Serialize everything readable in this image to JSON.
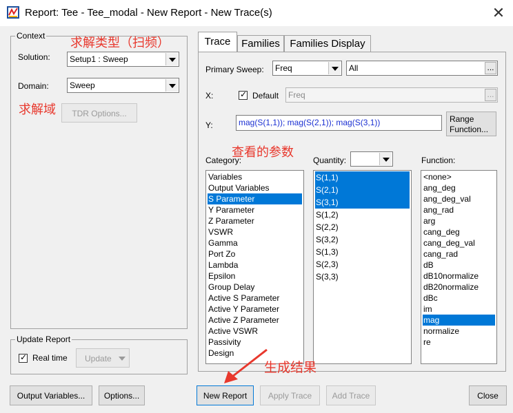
{
  "window": {
    "title": "Report: Tee - Tee_modal - New Report - New Trace(s)"
  },
  "context": {
    "group_label": "Context",
    "solution_label": "Solution:",
    "solution_value": "Setup1 : Sweep",
    "domain_label": "Domain:",
    "domain_value": "Sweep",
    "tdr_button": "TDR Options..."
  },
  "update_report": {
    "group_label": "Update Report",
    "realtime_label": "Real time",
    "realtime_checked": true,
    "update_button": "Update"
  },
  "tabs": [
    {
      "label": "Trace",
      "active": true
    },
    {
      "label": "Families",
      "active": false
    },
    {
      "label": "Families Display",
      "active": false
    }
  ],
  "trace": {
    "primary_sweep_label": "Primary Sweep:",
    "primary_sweep_value": "Freq",
    "primary_sweep_range": "All",
    "x_label": "X:",
    "default_label": "Default",
    "default_checked": true,
    "x_value": "Freq",
    "y_label": "Y:",
    "y_value": "mag(S(1,1)); mag(S(2,1)); mag(S(3,1))",
    "range_function_line1": "Range",
    "range_function_line2": "Function...",
    "ellipsis": "..."
  },
  "category": {
    "label": "Category:",
    "items": [
      "Variables",
      "Output Variables",
      "S Parameter",
      "Y Parameter",
      "Z Parameter",
      "VSWR",
      "Gamma",
      "Port Zo",
      "Lambda",
      "Epsilon",
      "Group Delay",
      "Active S Parameter",
      "Active Y Parameter",
      "Active Z Parameter",
      "Active VSWR",
      "Passivity",
      "Design"
    ],
    "selected": [
      2
    ]
  },
  "quantity": {
    "label": "Quantity:",
    "items": [
      "S(1,1)",
      "S(2,1)",
      "S(3,1)",
      "S(1,2)",
      "S(2,2)",
      "S(3,2)",
      "S(1,3)",
      "S(2,3)",
      "S(3,3)"
    ],
    "selected": [
      0,
      1,
      2
    ]
  },
  "function": {
    "label": "Function:",
    "items": [
      "<none>",
      "ang_deg",
      "ang_deg_val",
      "ang_rad",
      "arg",
      "cang_deg",
      "cang_deg_val",
      "cang_rad",
      "dB",
      "dB10normalize",
      "dB20normalize",
      "dBc",
      "im",
      "mag",
      "normalize",
      "re"
    ],
    "selected": [
      13
    ]
  },
  "buttons": {
    "output_variables": "Output Variables...",
    "options": "Options...",
    "new_report": "New Report",
    "apply_trace": "Apply Trace",
    "add_trace": "Add Trace",
    "close": "Close"
  },
  "annotations": {
    "solve_type": "求解类型（扫频）",
    "solve_domain": "求解域",
    "view_params": "查看的参数",
    "generate_result": "生成结果"
  },
  "colors": {
    "selection": "#0078d7",
    "annotation": "#e8382d"
  }
}
